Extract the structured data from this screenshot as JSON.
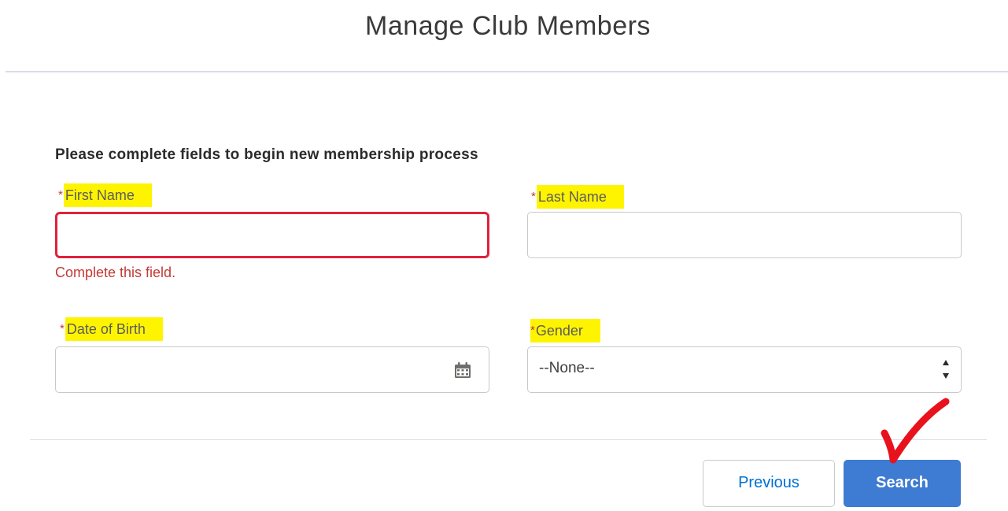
{
  "header": {
    "title": "Manage Club Members"
  },
  "form": {
    "instructions": "Please complete fields to begin new membership process",
    "required_marker": "*",
    "first_name": {
      "label": "First Name",
      "value": "",
      "error": "Complete this field."
    },
    "last_name": {
      "label": "Last Name",
      "value": ""
    },
    "date_of_birth": {
      "label": "Date of Birth",
      "value": "",
      "icon": "calendar-icon"
    },
    "gender": {
      "label": "Gender",
      "selected": "--None--",
      "icon": "select-arrows-icon"
    }
  },
  "footer": {
    "previous_label": "Previous",
    "search_label": "Search"
  },
  "colors": {
    "required": "#c23934",
    "error_border": "#e0213d",
    "highlight": "#fff400",
    "primary": "#3e7bd2",
    "link": "#0070d2",
    "annotation_check": "#e8121d"
  }
}
